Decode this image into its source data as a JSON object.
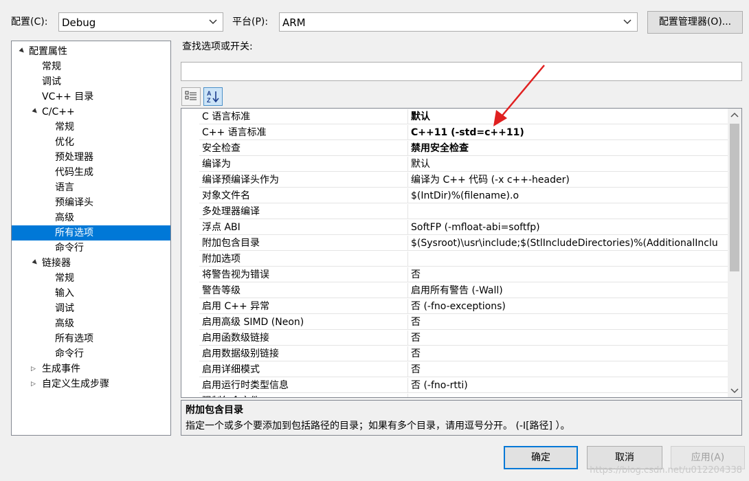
{
  "top_bar": {
    "config_label": "配置(C):",
    "config_value": "Debug",
    "platform_label": "平台(P):",
    "platform_value": "ARM",
    "config_manager_button": "配置管理器(O)..."
  },
  "search": {
    "label": "查找选项或开关:",
    "value": ""
  },
  "tree": [
    {
      "label": "配置属性",
      "expander": "▲",
      "level": 0
    },
    {
      "label": "常规",
      "level": 1
    },
    {
      "label": "调试",
      "level": 1
    },
    {
      "label": "VC++ 目录",
      "level": 1
    },
    {
      "label": "C/C++",
      "expander": "▲",
      "level": 1
    },
    {
      "label": "常规",
      "level": 2
    },
    {
      "label": "优化",
      "level": 2
    },
    {
      "label": "预处理器",
      "level": 2
    },
    {
      "label": "代码生成",
      "level": 2
    },
    {
      "label": "语言",
      "level": 2
    },
    {
      "label": "预编译头",
      "level": 2
    },
    {
      "label": "高级",
      "level": 2
    },
    {
      "label": "所有选项",
      "level": 2,
      "selected": true
    },
    {
      "label": "命令行",
      "level": 2
    },
    {
      "label": "链接器",
      "expander": "▲",
      "level": 1
    },
    {
      "label": "常规",
      "level": 2
    },
    {
      "label": "输入",
      "level": 2
    },
    {
      "label": "调试",
      "level": 2
    },
    {
      "label": "高级",
      "level": 2
    },
    {
      "label": "所有选项",
      "level": 2
    },
    {
      "label": "命令行",
      "level": 2
    },
    {
      "label": "生成事件",
      "expander": "▷",
      "level": 1
    },
    {
      "label": "自定义生成步骤",
      "expander": "▷",
      "level": 1
    }
  ],
  "properties": [
    {
      "name": "C 语言标准",
      "value": "默认",
      "bold": true
    },
    {
      "name": "C++ 语言标准",
      "value": "C++11 (-std=c++11)",
      "bold": true
    },
    {
      "name": "安全检查",
      "value": "禁用安全检查",
      "bold": true
    },
    {
      "name": "编译为",
      "value": "默认"
    },
    {
      "name": "编译预编译头作为",
      "value": "编译为 C++ 代码 (-x c++-header)"
    },
    {
      "name": "对象文件名",
      "value": "$(IntDir)%(filename).o"
    },
    {
      "name": "多处理器编译",
      "value": ""
    },
    {
      "name": "浮点 ABI",
      "value": "SoftFP (-mfloat-abi=softfp)"
    },
    {
      "name": "附加包含目录",
      "value": "$(Sysroot)\\usr\\include;$(StlIncludeDirectories)%(AdditionalInclu"
    },
    {
      "name": "附加选项",
      "value": ""
    },
    {
      "name": "将警告视为错误",
      "value": "否"
    },
    {
      "name": "警告等级",
      "value": "启用所有警告 (-Wall)"
    },
    {
      "name": "启用 C++ 异常",
      "value": "否 (-fno-exceptions)"
    },
    {
      "name": "启用高级 SIMD (Neon)",
      "value": "否"
    },
    {
      "name": "启用函数级链接",
      "value": "否"
    },
    {
      "name": "启用数据级别链接",
      "value": "否"
    },
    {
      "name": "启用详细模式",
      "value": "否"
    },
    {
      "name": "启用运行时类型信息",
      "value": "否 (-fno-rtti)"
    },
    {
      "name": "强制包含文件",
      "value": ""
    }
  ],
  "description": {
    "title": "附加包含目录",
    "text": "指定一个或多个要添加到包括路径的目录；如果有多个目录，请用逗号分开。 (-I[路径] ）。"
  },
  "buttons": {
    "ok": "确定",
    "cancel": "取消",
    "apply": "应用(A)"
  },
  "watermark": "https://blog.csdn.net/u012204338",
  "colors": {
    "selection": "#0078d7",
    "annotation_arrow": "#e02020"
  }
}
